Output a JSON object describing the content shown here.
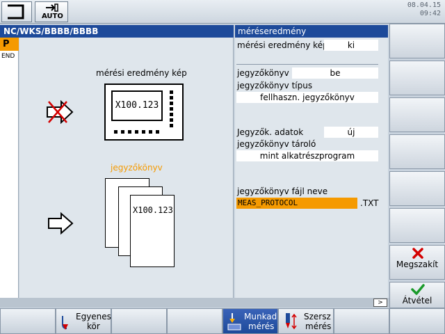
{
  "topbar": {
    "mode_label": "AUTO",
    "date": "08.04.15",
    "time": "09:42"
  },
  "header": {
    "path": "NC/WKS/BBBB/BBBB",
    "panel_title": "méréseredmény"
  },
  "program_strip": {
    "p_label": "P",
    "end_label": "END"
  },
  "graphics": {
    "image_caption": "mérési eredmény kép",
    "monitor_value": "X100.123",
    "protocol_caption": "jegyzőkönyv",
    "protocol_value": "X100.123",
    "protocol_caption_color": "#f59a00"
  },
  "params": {
    "result_image_label": "mérési eredmény kép",
    "result_image_value": "ki",
    "protocol_label": "jegyzőkönyv",
    "protocol_value": "be",
    "protocol_type_label": "jegyzőkönyv típus",
    "protocol_type_value": "fellhaszn. jegyzőkönyv",
    "protocol_data_label": "Jegyzők. adatok",
    "protocol_data_value": "új",
    "protocol_store_label": "jegyzőkönyv tároló",
    "protocol_store_value": "mint alkatrészprogram",
    "protocol_file_label": "jegyzőkönyv fájl neve",
    "protocol_file_value": "MEAS_PROTOCOL",
    "protocol_file_ext": ".TXT",
    "highlight_color": "#f59a00"
  },
  "right_softkeys": {
    "cancel_label": "Megszakít",
    "accept_label": "Átvétel"
  },
  "bottom_softkeys": {
    "k2_line1": "Egyenes",
    "k2_line2": "kör",
    "k5_line1": "Munkad",
    "k5_line2": "mérés",
    "k6_line1": "Szersz",
    "k6_line2": "mérés"
  },
  "scroll": {
    "right_arrow": ">"
  },
  "colors": {
    "header_blue": "#1d4a9a",
    "accent_orange": "#f59a00"
  }
}
